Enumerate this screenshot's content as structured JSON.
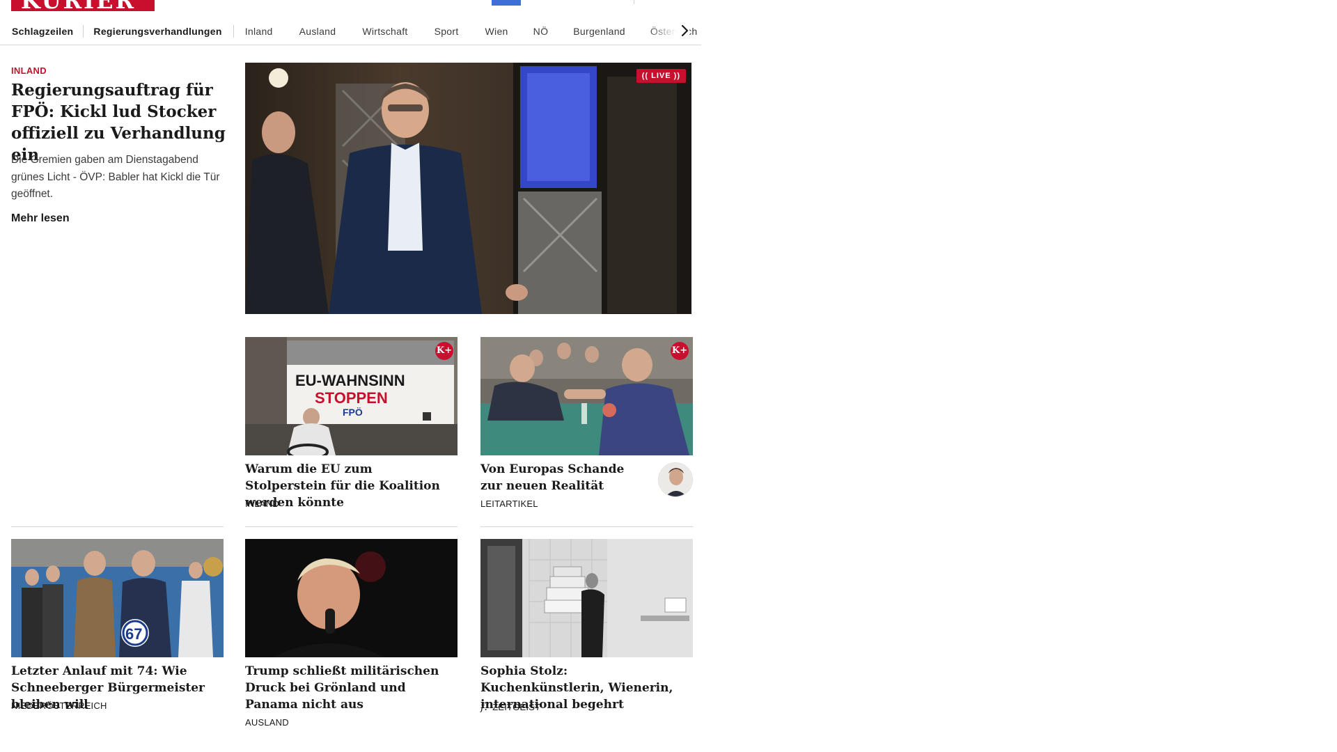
{
  "brand": {
    "logo_text": "KURIER",
    "color": "#c8102e"
  },
  "nav": {
    "items": [
      {
        "label": "Schlagzeilen",
        "bold": true
      },
      {
        "label": "Regierungsverhandlungen",
        "bold": true
      },
      {
        "label": "Inland"
      },
      {
        "label": "Ausland"
      },
      {
        "label": "Wirtschaft"
      },
      {
        "label": "Sport"
      },
      {
        "label": "Wien"
      },
      {
        "label": "NÖ"
      },
      {
        "label": "Burgenland"
      },
      {
        "label": "Österreich"
      }
    ],
    "next_icon": "chevron-right-icon"
  },
  "lead": {
    "kicker": "INLAND",
    "title": "Regierungsauftrag für FPÖ: Kickl lud Stocker offiziell zu Verhandlung ein",
    "teaser": "Die Gremien gaben am Dienstagabend grünes Licht - ÖVP: Babler hat Kickl die Tür geöffnet.",
    "more_label": "Mehr lesen",
    "badge": "LIVE",
    "image_alt": "Herbert Kickl im Parlament"
  },
  "cards_row1": [
    {
      "title": "Warum die EU zum Stolperstein für die Koalition werden könnte",
      "tag": "INLAND",
      "badge": "K+",
      "image_text_1": "EU-WAHNSINN",
      "image_text_2": "STOPPEN",
      "image_text_3": "FPÖ"
    },
    {
      "title": "Von Europas Schande zur neuen Realität",
      "tag": "LEITARTIKEL",
      "badge": "K+"
    }
  ],
  "cards_row2": [
    {
      "title": "Letzter Anlauf mit 74: Wie Schneeberger Bürgermeister bleiben will",
      "tag": "NIEDERÖSTERREICH",
      "image_text": "67"
    },
    {
      "title": "Trump schließt militärischen Druck bei Grönland und Panama nicht aus",
      "tag": "AUSLAND"
    },
    {
      "title": "Sophia Stolz: Kuchenkünstlerin, Wienerin, international begehrt",
      "tag": "ZEITGEIST",
      "tag_icon": "f."
    }
  ]
}
